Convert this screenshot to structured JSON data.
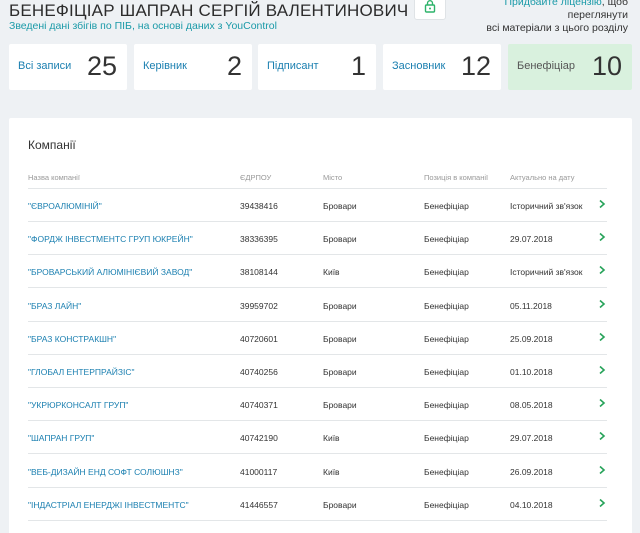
{
  "header": {
    "title": "БЕНЕФІЦІАР ШАПРАН СЕРГІЙ ВАЛЕНТИНОВИЧ",
    "subtitle": "Зведені дані збігів по ПІБ, на основі даних з YouControl",
    "promo_link": "Придбайте ліцензію",
    "promo_rest_1": ", щоб переглянути",
    "promo_rest_2": "всі матеріали з цього розділу",
    "lock_icon": "lock-icon"
  },
  "stats": [
    {
      "label": "Всі записи",
      "count": "25",
      "active": false
    },
    {
      "label": "Керівник",
      "count": "2",
      "active": false
    },
    {
      "label": "Підписант",
      "count": "1",
      "active": false
    },
    {
      "label": "Засновник",
      "count": "12",
      "active": false
    },
    {
      "label": "Бенефіціар",
      "count": "10",
      "active": true
    }
  ],
  "companies": {
    "title": "Компанії",
    "columns": [
      "Назва компанії",
      "ЄДРПОУ",
      "Місто",
      "Позиція в компанії",
      "Актуально на дату"
    ],
    "rows": [
      {
        "name": "\"ЄВРОАЛЮМІНІЙ\"",
        "code": "39438416",
        "city": "Бровари",
        "position": "Бенефіціар",
        "date": "Історичний зв'язок"
      },
      {
        "name": "\"ФОРДЖ ІНВЕСТМЕНТС ГРУП ЮКРЕЙН\"",
        "code": "38336395",
        "city": "Бровари",
        "position": "Бенефіціар",
        "date": "29.07.2018"
      },
      {
        "name": "\"БРОВАРСЬКИЙ АЛЮМІНІЄВИЙ ЗАВОД\"",
        "code": "38108144",
        "city": "Київ",
        "position": "Бенефіціар",
        "date": "Історичний зв'язок"
      },
      {
        "name": "\"БРАЗ ЛАЙН\"",
        "code": "39959702",
        "city": "Бровари",
        "position": "Бенефіціар",
        "date": "05.11.2018"
      },
      {
        "name": "\"БРАЗ КОНСТРАКШН\"",
        "code": "40720601",
        "city": "Бровари",
        "position": "Бенефіціар",
        "date": "25.09.2018"
      },
      {
        "name": "\"ГЛОБАЛ ЕНТЕРПРАЙЗІС\"",
        "code": "40740256",
        "city": "Бровари",
        "position": "Бенефіціар",
        "date": "01.10.2018"
      },
      {
        "name": "\"УКРЮРКОНСАЛТ ГРУП\"",
        "code": "40740371",
        "city": "Бровари",
        "position": "Бенефіціар",
        "date": "08.05.2018"
      },
      {
        "name": "\"ШАПРАН ГРУП\"",
        "code": "40742190",
        "city": "Київ",
        "position": "Бенефіціар",
        "date": "29.07.2018"
      },
      {
        "name": "\"ВЕБ-ДИЗАЙН ЕНД СОФТ СОЛЮШНЗ\"",
        "code": "41000117",
        "city": "Київ",
        "position": "Бенефіціар",
        "date": "26.09.2018"
      },
      {
        "name": "\"ІНДАСТРІАЛ ЕНЕРДЖІ ІНВЕСТМЕНТС\"",
        "code": "41446557",
        "city": "Бровари",
        "position": "Бенефіціар",
        "date": "04.10.2018"
      }
    ]
  },
  "colors": {
    "accent": "#1a7fb0",
    "teal": "#1a9aa8",
    "active_bg": "#d9f1de",
    "chevron": "#27a35a"
  }
}
